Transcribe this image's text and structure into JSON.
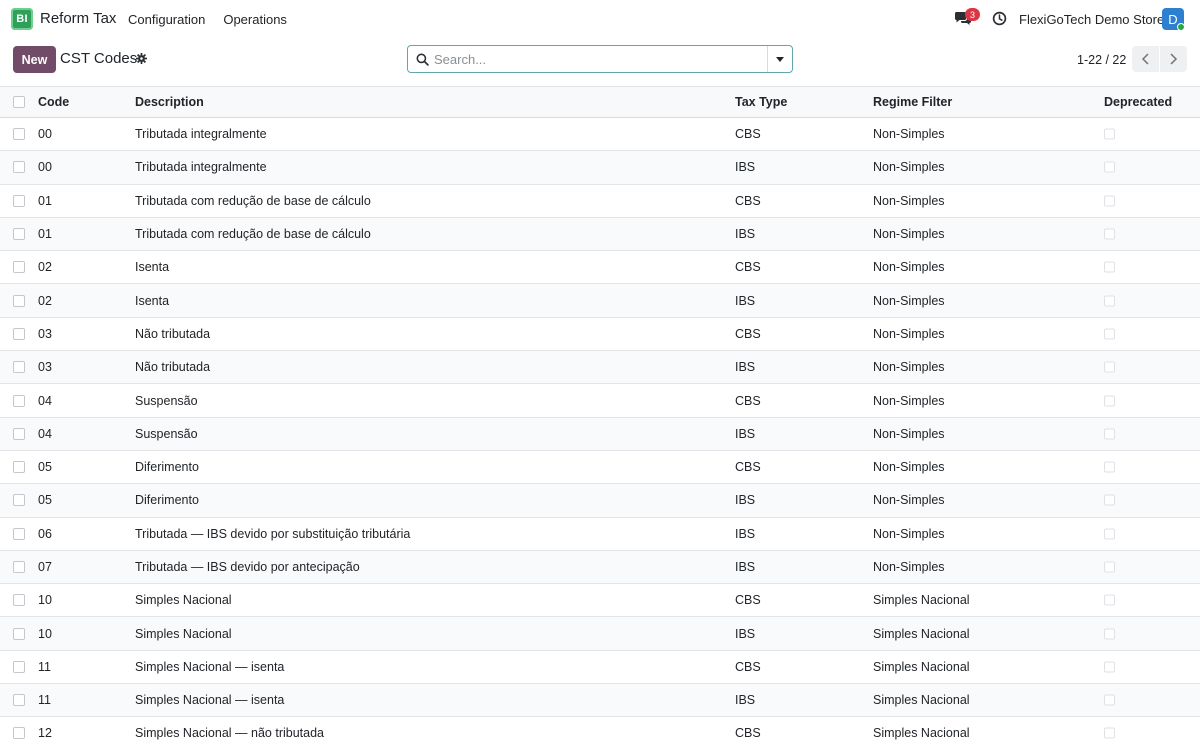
{
  "navbar": {
    "logo_text": "BI",
    "app_name": "Reform Tax",
    "menu": [
      {
        "label": "Configuration"
      },
      {
        "label": "Operations"
      }
    ],
    "chat_badge": "3",
    "company": "FlexiGoTech Demo Store",
    "avatar_letter": "D"
  },
  "control": {
    "new_label": "New",
    "title": "CST Codes",
    "search_placeholder": "Search...",
    "pager": "1-22 / 22"
  },
  "table": {
    "headers": {
      "code": "Code",
      "description": "Description",
      "tax_type": "Tax Type",
      "regime": "Regime Filter",
      "deprecated": "Deprecated"
    },
    "rows": [
      {
        "code": "00",
        "description": "Tributada integralmente",
        "tax_type": "CBS",
        "regime": "Non-Simples"
      },
      {
        "code": "00",
        "description": "Tributada integralmente",
        "tax_type": "IBS",
        "regime": "Non-Simples"
      },
      {
        "code": "01",
        "description": "Tributada com redução de base de cálculo",
        "tax_type": "CBS",
        "regime": "Non-Simples"
      },
      {
        "code": "01",
        "description": "Tributada com redução de base de cálculo",
        "tax_type": "IBS",
        "regime": "Non-Simples"
      },
      {
        "code": "02",
        "description": "Isenta",
        "tax_type": "CBS",
        "regime": "Non-Simples"
      },
      {
        "code": "02",
        "description": "Isenta",
        "tax_type": "IBS",
        "regime": "Non-Simples"
      },
      {
        "code": "03",
        "description": "Não tributada",
        "tax_type": "CBS",
        "regime": "Non-Simples"
      },
      {
        "code": "03",
        "description": "Não tributada",
        "tax_type": "IBS",
        "regime": "Non-Simples"
      },
      {
        "code": "04",
        "description": "Suspensão",
        "tax_type": "CBS",
        "regime": "Non-Simples"
      },
      {
        "code": "04",
        "description": "Suspensão",
        "tax_type": "IBS",
        "regime": "Non-Simples"
      },
      {
        "code": "05",
        "description": "Diferimento",
        "tax_type": "CBS",
        "regime": "Non-Simples"
      },
      {
        "code": "05",
        "description": "Diferimento",
        "tax_type": "IBS",
        "regime": "Non-Simples"
      },
      {
        "code": "06",
        "description": "Tributada — IBS devido por substituição tributária",
        "tax_type": "IBS",
        "regime": "Non-Simples"
      },
      {
        "code": "07",
        "description": "Tributada — IBS devido por antecipação",
        "tax_type": "IBS",
        "regime": "Non-Simples"
      },
      {
        "code": "10",
        "description": "Simples Nacional",
        "tax_type": "CBS",
        "regime": "Simples Nacional"
      },
      {
        "code": "10",
        "description": "Simples Nacional",
        "tax_type": "IBS",
        "regime": "Simples Nacional"
      },
      {
        "code": "11",
        "description": "Simples Nacional — isenta",
        "tax_type": "CBS",
        "regime": "Simples Nacional"
      },
      {
        "code": "11",
        "description": "Simples Nacional — isenta",
        "tax_type": "IBS",
        "regime": "Simples Nacional"
      },
      {
        "code": "12",
        "description": "Simples Nacional — não tributada",
        "tax_type": "CBS",
        "regime": "Simples Nacional"
      }
    ]
  },
  "colors": {
    "brand": "#714b67",
    "logo_bg": "#2ea05a",
    "badge": "#dc3545",
    "avatar": "#2d7fd1",
    "search_border": "#5fa7a9"
  },
  "icons": {
    "chat": "chat-bubbles-icon",
    "clock": "clock-icon",
    "gear": "gear-icon",
    "search": "search-icon",
    "prev": "chevron-left-icon",
    "next": "chevron-right-icon",
    "toggle": "caret-down-icon"
  }
}
